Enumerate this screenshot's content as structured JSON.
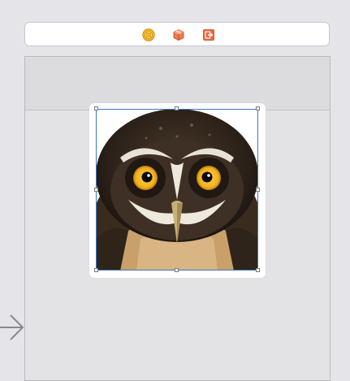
{
  "canvas": {
    "background": "#e5e5e9"
  },
  "scene_dock": {
    "icons": [
      {
        "name": "view-controller-icon",
        "color": "#f5a623"
      },
      {
        "name": "first-responder-icon",
        "color": "#e8643c"
      },
      {
        "name": "exit-icon",
        "color": "#f0663a"
      }
    ]
  },
  "view_controller": {
    "background": "#e3e3e6",
    "top_bar_color": "#dcdcdf"
  },
  "image_view": {
    "content": "owl photo",
    "selected": true,
    "selection_color": "#3b79c9"
  },
  "entry_point": {
    "icon": "arrow-right-icon"
  }
}
